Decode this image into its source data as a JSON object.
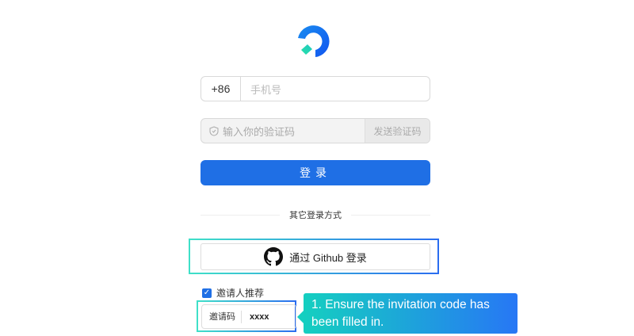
{
  "phone": {
    "prefix": "+86",
    "placeholder": "手机号"
  },
  "code": {
    "placeholder": "输入你的验证码",
    "send_label": "发送验证码"
  },
  "login_label": "登录",
  "divider_label": "其它登录方式",
  "github_label": "通过 Github 登录",
  "referral": {
    "checked": true,
    "label": "邀请人推荐",
    "field_label": "邀请码",
    "value": "xxxx"
  },
  "tooltip": "1. Ensure the invitation code has been filled in.",
  "colors": {
    "primary": "#1f6fe5",
    "highlight_start": "#3fe0c8",
    "highlight_end": "#2a6df0"
  }
}
